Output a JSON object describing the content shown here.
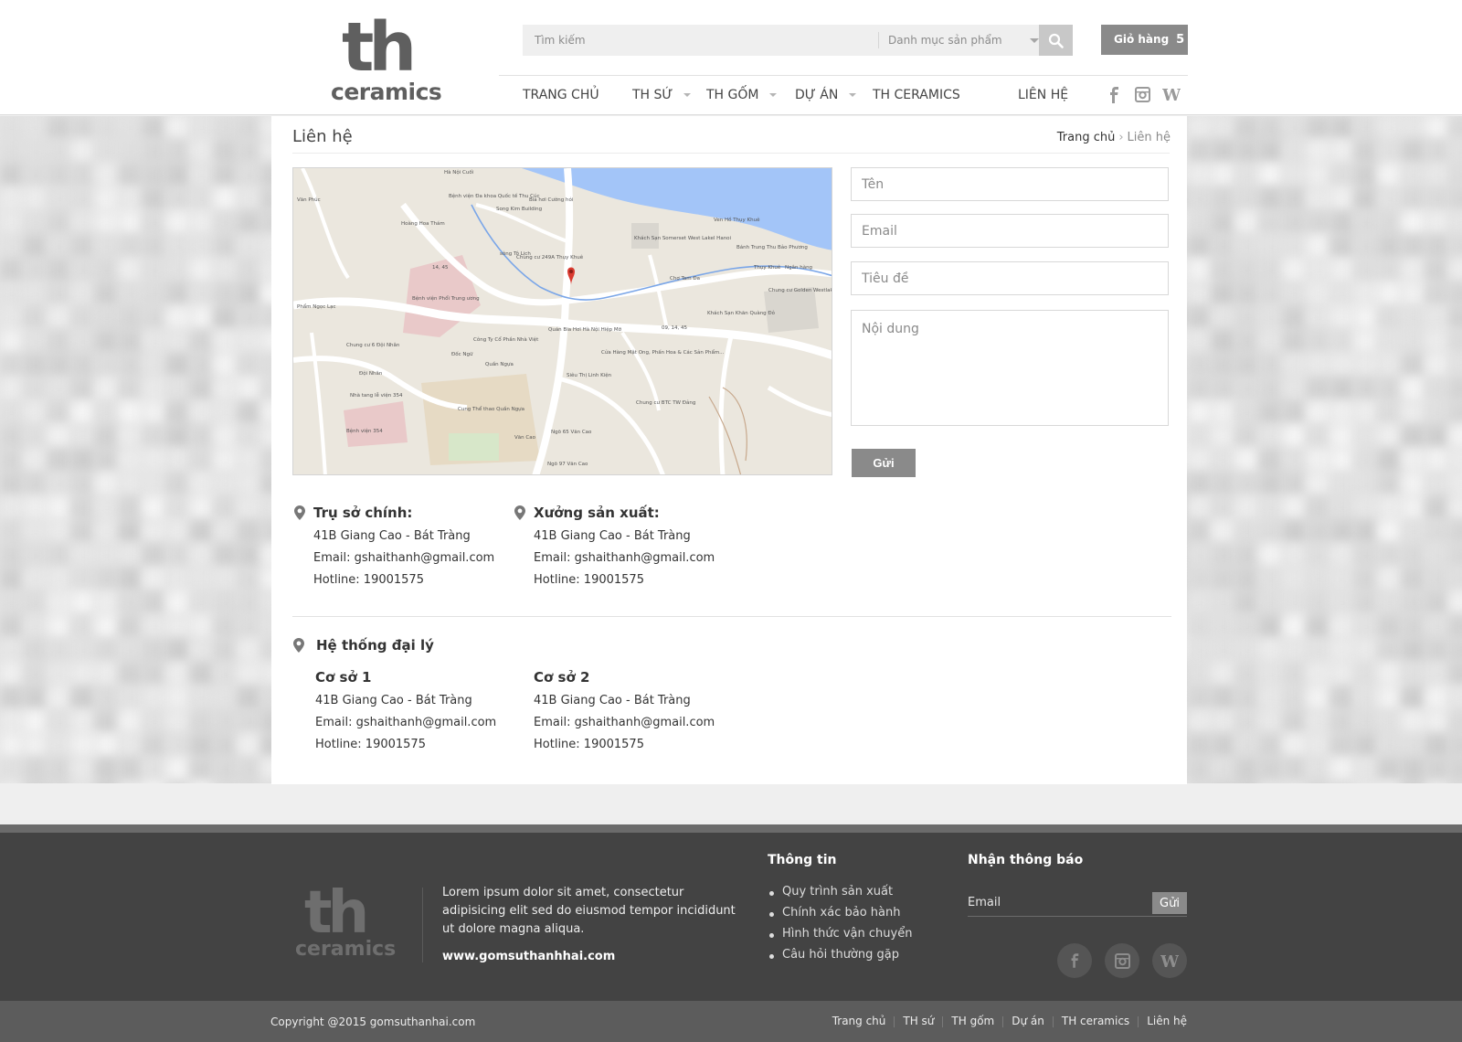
{
  "header": {
    "logo_top": "th",
    "logo_bottom": "ceramics",
    "search_placeholder": "Tìm kiếm",
    "category_label": "Danh mục sản phẩm",
    "cart_label": "Giỏ hàng",
    "cart_count": "5",
    "nav": [
      "TRANG CHỦ",
      "TH SỨ",
      "TH GỐM",
      "DỰ ÁN",
      "TH CERAMICS",
      "LIÊN HỆ"
    ]
  },
  "page": {
    "title": "Liên hệ",
    "breadcrumb": {
      "home": "Trang chủ",
      "current": "Liên hệ"
    }
  },
  "form": {
    "name_placeholder": "Tên",
    "email_placeholder": "Email",
    "subject_placeholder": "Tiêu đề",
    "message_placeholder": "Nội dung",
    "submit_label": "Gửi"
  },
  "map": {
    "labels": [
      "Hà Nội Cuối",
      "Bệnh viện Đa khoa Quốc tế Thu Cúc",
      "Bia hơi Cường hói",
      "Song Kim Building",
      "Khách Sạn Somerset West Lakel Hanoi",
      "Bánh Trung Thu Bảo Phương",
      "Chung cư 249A Thụy Khuê",
      "Chợ Tam Đa",
      "Ngân hàng",
      "Chung cư Golden Westlake",
      "Bệnh viện Phổi Trung ương",
      "Phẩm Ngọc Lạc",
      "Khách Sạn Khăn Quàng Đỏ",
      "Quán Bia Hơi Hà Nội Hiệp Mỡ",
      "Công Ty Cổ Phần Nhà Việt",
      "Chung cư 6 Đội Nhân",
      "Cửa Hàng Mật Ong, Phấn Hoa & Các Sản Phẩm...",
      "Siêu Thị Linh Kiện",
      "Nhà tang lễ viện 354",
      "Bệnh viện 354",
      "Cung Thể thao Quần Ngựa",
      "Chung cư BTC TW Đảng",
      "Văn Phúc",
      "Hoàng Hoa Thám",
      "Thụy Khuê",
      "Đốc Ngữ",
      "Quần Ngựa",
      "Văn Cao",
      "Đội Nhân",
      "Ngõ 65 Văn Cao",
      "Ngõ 97 Văn Cao",
      "Ven Hồ Thụy Khuê",
      "sông Tô Lịch",
      "14, 45",
      "09, 14, 45"
    ]
  },
  "offices": [
    {
      "title": "Trụ sở chính:",
      "address": "41B Giang Cao - Bát Tràng",
      "email": "Email: gshaithanh@gmail.com",
      "hotline": "Hotline: 19001575"
    },
    {
      "title": "Xưởng sản xuất:",
      "address": "41B Giang Cao - Bát Tràng",
      "email": "Email: gshaithanh@gmail.com",
      "hotline": "Hotline: 19001575"
    }
  ],
  "agency": {
    "title": "Hệ thống đại lý",
    "branches": [
      {
        "title": "Cơ sở 1",
        "address": "41B Giang Cao - Bát Tràng",
        "email": "Email: gshaithanh@gmail.com",
        "hotline": "Hotline: 19001575"
      },
      {
        "title": "Cơ sở 2",
        "address": "41B Giang Cao - Bát Tràng",
        "email": "Email: gshaithanh@gmail.com",
        "hotline": "Hotline: 19001575"
      }
    ]
  },
  "footer": {
    "logo_top": "th",
    "logo_bottom": "ceramics",
    "description": "Lorem ipsum dolor sit amet, consectetur adipisicing elit sed do eiusmod tempor incididunt ut dolore magna aliqua.",
    "website": "www.gomsuthanhhai.com",
    "info_title": "Thông tin",
    "info_links": [
      "Quy trình sản xuất",
      "Chính xác bảo hành",
      "Hình thức vận chuyển",
      "Câu hỏi thường gặp"
    ],
    "newsletter_title": "Nhận thông báo",
    "newsletter_placeholder": "Email",
    "newsletter_button": "Gửi",
    "copyright": "Copyright @2015 gomsuthanhai.com",
    "bottom_links": [
      "Trang chủ",
      "TH sứ",
      "TH gốm",
      "Dự án",
      "TH ceramics",
      "Liên hệ"
    ]
  },
  "colors": {
    "accent_gray": "#8a8a8a",
    "footer_bg": "#434343",
    "map_water": "#a3c5f8",
    "map_pin": "#d93a2f"
  }
}
